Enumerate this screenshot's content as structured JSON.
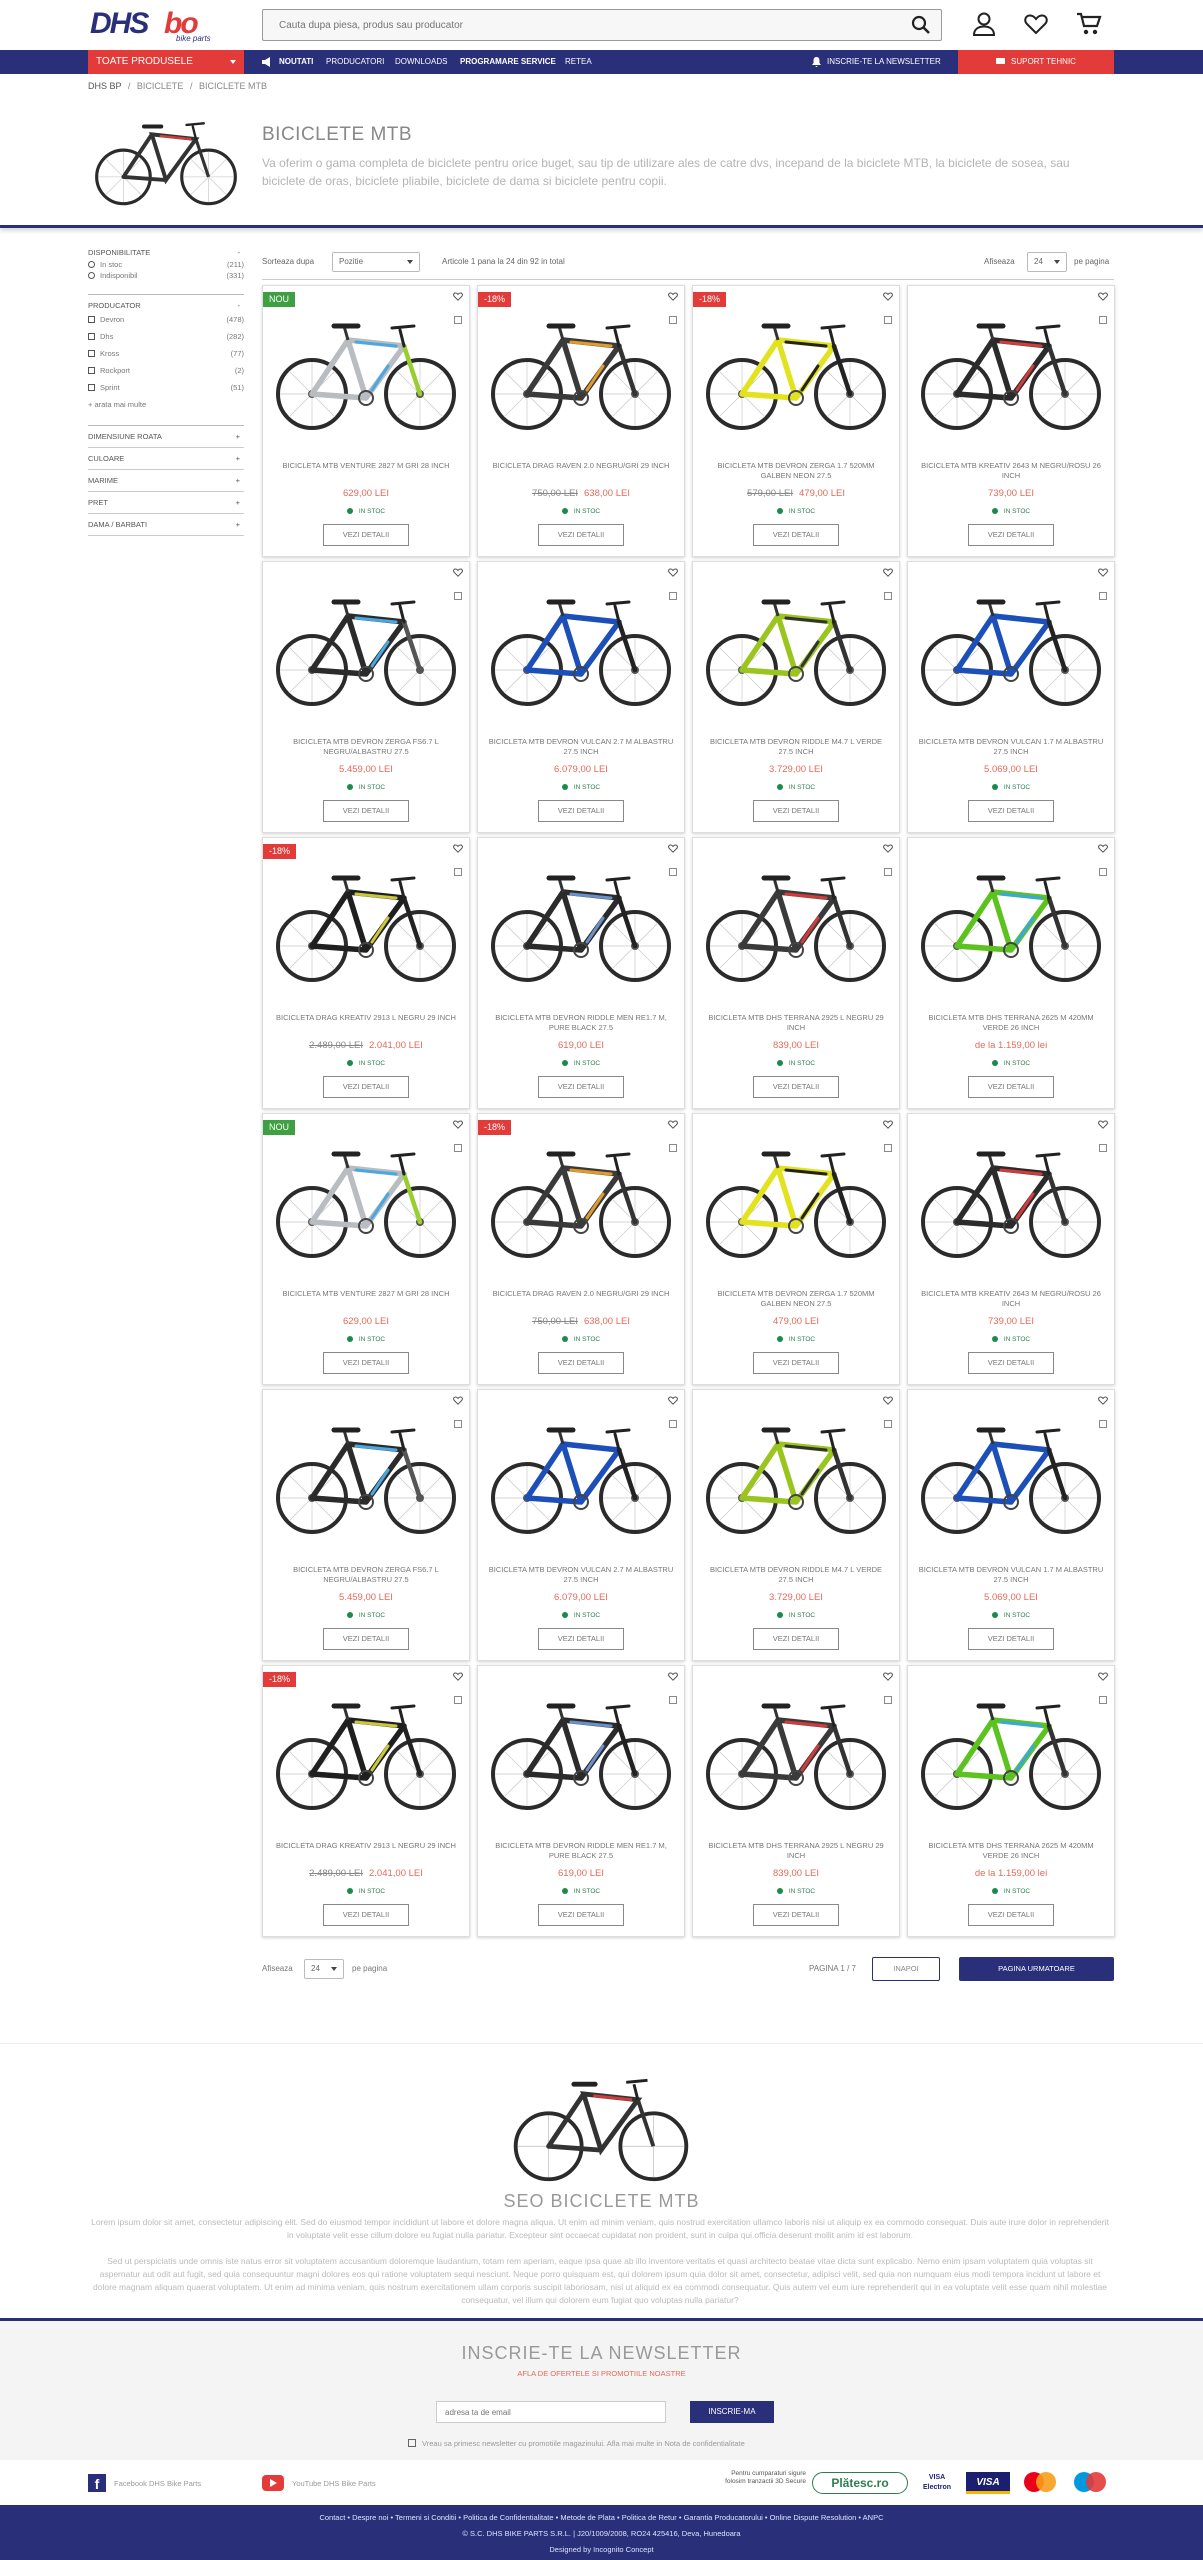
{
  "header": {
    "logo_text": "DHS",
    "logo_suffix": "bike parts",
    "search_placeholder": "Cauta dupa piesa, produs sau producator"
  },
  "nav": {
    "all_products": "TOATE PRODUSELE",
    "items": [
      "NOUTATI",
      "PRODUCATORI",
      "DOWNLOADS",
      "PROGRAMARE SERVICE",
      "RETEA"
    ],
    "newsletter": "INSCRIE-TE LA NEWSLETTER",
    "support": "SUPORT TEHNIC"
  },
  "breadcrumb": [
    "DHS BP",
    "BICICLETE",
    "BICICLETE MTB"
  ],
  "category": {
    "title": "BICICLETE MTB",
    "description": "Va oferim o gama completa de biciclete pentru orice buget, sau tip de utilizare ales de catre dvs, incepand de la biciclete MTB, la biciclete de sosea, sau biciclete de oras, biciclete pliabile, biciclete de dama si biciclete pentru copii."
  },
  "filters": {
    "availability": {
      "title": "DISPONIBILITATE",
      "toggle": "-",
      "items": [
        {
          "label": "In stoc",
          "count": "(211)"
        },
        {
          "label": "Indisponibil",
          "count": "(331)"
        }
      ]
    },
    "producer": {
      "title": "PRODUCATOR",
      "toggle": "-",
      "items": [
        {
          "label": "Devron",
          "count": "(478)"
        },
        {
          "label": "Dhs",
          "count": "(282)"
        },
        {
          "label": "Kross",
          "count": "(77)"
        },
        {
          "label": "Rockport",
          "count": "(2)"
        },
        {
          "label": "Sprint",
          "count": "(51)"
        }
      ],
      "more": "+ arata mai multe"
    },
    "collapsed": [
      {
        "label": "DIMENSIUNE ROATA",
        "toggle": "+"
      },
      {
        "label": "CULOARE",
        "toggle": "+"
      },
      {
        "label": "MARIME",
        "toggle": "+"
      },
      {
        "label": "PRET",
        "toggle": "+"
      },
      {
        "label": "DAMA / BARBATI",
        "toggle": "+"
      }
    ]
  },
  "toolbar": {
    "sort_label": "Sorteaza dupa",
    "sort_value": "Pozitie",
    "count_text": "Articole 1 pana la 24 din 92 in total",
    "show_label": "Afiseaza",
    "per_page_value": "24",
    "per_page_suffix": "pe pagina"
  },
  "products": [
    {
      "name": "BICICLETA MTB VENTURE 2827 M GRI 28 INCH",
      "price": "629,00 LEI",
      "old_price": "",
      "badge": "NOU",
      "badge_type": "new",
      "stock": "IN STOC",
      "button": "VEZI DETALII",
      "frame": "#b9bcc0",
      "accent": "#4aa8e0",
      "fork": "#9acd32"
    },
    {
      "name": "BICICLETA DRAG RAVEN 2.0 NEGRU/GRI 29 INCH",
      "price": "638,00 LEI",
      "old_price": "750,00 LEI",
      "badge": "-18%",
      "badge_type": "sale",
      "stock": "IN STOC",
      "button": "VEZI DETALII",
      "frame": "#3a3a3a",
      "accent": "#e29b2a",
      "fork": "#333333"
    },
    {
      "name": "BICICLETA MTB DEVRON ZERGA 1.7 520MM GALBEN NEON 27.5",
      "price": "479,00 LEI",
      "old_price": "579,00 LEI",
      "badge": "-18%",
      "badge_type": "sale",
      "stock": "IN STOC",
      "button": "VEZI DETALII",
      "frame": "#e3e21f",
      "accent": "#222222",
      "fork": "#222222"
    },
    {
      "name": "BICICLETA MTB KREATIV 2643 M NEGRU/ROSU 26 INCH",
      "price": "739,00 LEI",
      "old_price": "",
      "badge": "",
      "badge_type": "",
      "stock": "IN STOC",
      "button": "VEZI DETALII",
      "frame": "#2b2b2b",
      "accent": "#d23b3b",
      "fork": "#333333"
    },
    {
      "name": "BICICLETA MTB DEVRON ZERGA FS6.7 L NEGRU/ALBASTRU 27.5",
      "price": "5.459,00 LEI",
      "old_price": "",
      "badge": "",
      "badge_type": "",
      "stock": "IN STOC",
      "button": "VEZI DETALII",
      "frame": "#2b2b2b",
      "accent": "#4aa8e0",
      "fork": "#555555"
    },
    {
      "name": "BICICLETA MTB DEVRON VULCAN 2.7 M ALBASTRU 27.5 INCH",
      "price": "6.079,00 LEI",
      "old_price": "",
      "badge": "",
      "badge_type": "",
      "stock": "IN STOC",
      "button": "VEZI DETALII",
      "frame": "#1d4fb8",
      "accent": "#1d4fb8",
      "fork": "#222222"
    },
    {
      "name": "BICICLETA MTB DEVRON RIDDLE M4.7 L VERDE 27.5 INCH",
      "price": "3.729,00 LEI",
      "old_price": "",
      "badge": "",
      "badge_type": "",
      "stock": "IN STOC",
      "button": "VEZI DETALII",
      "frame": "#9ac51f",
      "accent": "#333333",
      "fork": "#333333"
    },
    {
      "name": "BICICLETA MTB DEVRON VULCAN 1.7 M ALBASTRU 27.5 INCH",
      "price": "5.069,00 LEI",
      "old_price": "",
      "badge": "",
      "badge_type": "",
      "stock": "IN STOC",
      "button": "VEZI DETALII",
      "frame": "#1d4fb8",
      "accent": "#1d4fb8",
      "fork": "#222222"
    },
    {
      "name": "BICICLETA DRAG KREATIV 2913 L NEGRU 29 INCH",
      "price": "2.041,00 LEI",
      "old_price": "2.489,00 LEI",
      "badge": "-18%",
      "badge_type": "sale",
      "stock": "IN STOC",
      "button": "VEZI DETALII",
      "frame": "#1f1f1f",
      "accent": "#c8c83a",
      "fork": "#222222"
    },
    {
      "name": "BICICLETA MTB DEVRON RIDDLE MEN RE1.7 M, PURE BLACK 27.5",
      "price": "619,00 LEI",
      "old_price": "",
      "badge": "",
      "badge_type": "",
      "stock": "IN STOC",
      "button": "VEZI DETALII",
      "frame": "#2b2b2b",
      "accent": "#6b8fc9",
      "fork": "#222222"
    },
    {
      "name": "BICICLETA MTB DHS TERRANA 2925 L NEGRU 29 INCH",
      "price": "839,00 LEI",
      "old_price": "",
      "badge": "",
      "badge_type": "",
      "stock": "IN STOC",
      "button": "VEZI DETALII",
      "frame": "#3a3a3a",
      "accent": "#d23b3b",
      "fork": "#333333"
    },
    {
      "name": "BICICLETA MTB DHS TERRANA 2625 M 420MM VERDE 26 INCH",
      "price": "de la 1.159,00 lei",
      "old_price": "",
      "badge": "",
      "badge_type": "",
      "stock": "IN STOC",
      "button": "VEZI DETALII",
      "frame": "#5cc21f",
      "accent": "#3aa8e0",
      "fork": "#333333"
    },
    {
      "name": "BICICLETA MTB VENTURE 2827 M GRI 28 INCH",
      "price": "629,00 LEI",
      "old_price": "",
      "badge": "NOU",
      "badge_type": "new",
      "stock": "IN STOC",
      "button": "VEZI DETALII",
      "frame": "#b9bcc0",
      "accent": "#4aa8e0",
      "fork": "#9acd32"
    },
    {
      "name": "BICICLETA DRAG RAVEN 2.0 NEGRU/GRI 29 INCH",
      "price": "638,00 LEI",
      "old_price": "750,00 LEI",
      "badge": "-18%",
      "badge_type": "sale",
      "stock": "IN STOC",
      "button": "VEZI DETALII",
      "frame": "#3a3a3a",
      "accent": "#e29b2a",
      "fork": "#333333"
    },
    {
      "name": "BICICLETA MTB DEVRON ZERGA 1.7 520MM GALBEN NEON 27.5",
      "price": "479,00 LEI",
      "old_price": "",
      "badge": "",
      "badge_type": "",
      "stock": "IN STOC",
      "button": "VEZI DETALII",
      "frame": "#e3e21f",
      "accent": "#222222",
      "fork": "#222222"
    },
    {
      "name": "BICICLETA MTB KREATIV 2643 M NEGRU/ROSU 26 INCH",
      "price": "739,00 LEI",
      "old_price": "",
      "badge": "",
      "badge_type": "",
      "stock": "IN STOC",
      "button": "VEZI DETALII",
      "frame": "#2b2b2b",
      "accent": "#d23b3b",
      "fork": "#333333"
    },
    {
      "name": "BICICLETA MTB DEVRON ZERGA FS6.7 L NEGRU/ALBASTRU 27.5",
      "price": "5.459,00 LEI",
      "old_price": "",
      "badge": "",
      "badge_type": "",
      "stock": "IN STOC",
      "button": "VEZI DETALII",
      "frame": "#2b2b2b",
      "accent": "#4aa8e0",
      "fork": "#555555"
    },
    {
      "name": "BICICLETA MTB DEVRON VULCAN 2.7 M ALBASTRU 27.5 INCH",
      "price": "6.079,00 LEI",
      "old_price": "",
      "badge": "",
      "badge_type": "",
      "stock": "IN STOC",
      "button": "VEZI DETALII",
      "frame": "#1d4fb8",
      "accent": "#1d4fb8",
      "fork": "#222222"
    },
    {
      "name": "BICICLETA MTB DEVRON RIDDLE M4.7 L VERDE 27.5 INCH",
      "price": "3.729,00 LEI",
      "old_price": "",
      "badge": "",
      "badge_type": "",
      "stock": "IN STOC",
      "button": "VEZI DETALII",
      "frame": "#9ac51f",
      "accent": "#333333",
      "fork": "#333333"
    },
    {
      "name": "BICICLETA MTB DEVRON VULCAN 1.7 M ALBASTRU 27.5 INCH",
      "price": "5.069,00 LEI",
      "old_price": "",
      "badge": "",
      "badge_type": "",
      "stock": "IN STOC",
      "button": "VEZI DETALII",
      "frame": "#1d4fb8",
      "accent": "#1d4fb8",
      "fork": "#222222"
    },
    {
      "name": "BICICLETA DRAG KREATIV 2913 L NEGRU 29 INCH",
      "price": "2.041,00 LEI",
      "old_price": "2.489,00 LEI",
      "badge": "-18%",
      "badge_type": "sale",
      "stock": "IN STOC",
      "button": "VEZI DETALII",
      "frame": "#1f1f1f",
      "accent": "#c8c83a",
      "fork": "#222222"
    },
    {
      "name": "BICICLETA MTB DEVRON RIDDLE MEN RE1.7 M, PURE BLACK 27.5",
      "price": "619,00 LEI",
      "old_price": "",
      "badge": "",
      "badge_type": "",
      "stock": "IN STOC",
      "button": "VEZI DETALII",
      "frame": "#2b2b2b",
      "accent": "#6b8fc9",
      "fork": "#222222"
    },
    {
      "name": "BICICLETA MTB DHS TERRANA 2925 L NEGRU 29 INCH",
      "price": "839,00 LEI",
      "old_price": "",
      "badge": "",
      "badge_type": "",
      "stock": "IN STOC",
      "button": "VEZI DETALII",
      "frame": "#3a3a3a",
      "accent": "#d23b3b",
      "fork": "#333333"
    },
    {
      "name": "BICICLETA MTB DHS TERRANA 2625 M 420MM VERDE 26 INCH",
      "price": "de la 1.159,00 lei",
      "old_price": "",
      "badge": "",
      "badge_type": "",
      "stock": "IN STOC",
      "button": "VEZI DETALII",
      "frame": "#5cc21f",
      "accent": "#3aa8e0",
      "fork": "#333333"
    }
  ],
  "pagination": {
    "show_label": "Afiseaza",
    "per_page_value": "24",
    "per_page_suffix": "pe pagina",
    "page_text": "PAGINA 1 / 7",
    "back": "INAPOI",
    "next": "PAGINA URMATOARE"
  },
  "seo": {
    "title": "SEO BICICLETE MTB",
    "paragraph1": "Lorem ipsum dolor sit amet, consectetur adipiscing elit. Sed do eiusmod tempor incididunt ut labore et dolore magna aliqua. Ut enim ad minim veniam, quis nostrud exercitation ullamco laboris nisi ut aliquip ex ea commodo consequat. Duis aute irure dolor in reprehenderit in voluptate velit esse cillum dolore eu fugiat nulla pariatur. Excepteur sint occaecat cupidatat non proident, sunt in culpa qui officia deserunt mollit anim id est laborum.",
    "paragraph2": "Sed ut perspiciatis unde omnis iste natus error sit voluptatem accusantium doloremque laudantium, totam rem aperiam, eaque ipsa quae ab illo inventore veritatis et quasi architecto beatae vitae dicta sunt explicabo. Nemo enim ipsam voluptatem quia voluptas sit aspernatur aut odit aut fugit, sed quia consequuntur magni dolores eos qui ratione voluptatem sequi nesciunt. Neque porro quisquam est, qui dolorem ipsum quia dolor sit amet, consectetur, adipisci velit, sed quia non numquam eius modi tempora incidunt ut labore et dolore magnam aliquam quaerat voluptatem. Ut enim ad minima veniam, quis nostrum exercitationem ullam corporis suscipit laboriosam, nisi ut aliquid ex ea commodi consequatur. Quis autem vel eum iure reprehenderit qui in ea voluptate velit esse quam nihil molestiae consequatur, vel illum qui dolorem eum fugiat quo voluptas nulla pariatur?"
  },
  "newsletter": {
    "title": "INSCRIE-TE LA NEWSLETTER",
    "subtitle": "AFLA DE OFERTELE SI PROMOTIILE NOASTRE",
    "placeholder": "adresa ta de email",
    "button": "INSCRIE-MA",
    "agree": "Vreau sa primesc newsletter cu promotiile magazinului. Afla mai multe in Nota de confidentialitate"
  },
  "social": {
    "facebook": "Facebook DHS Bike Parts",
    "youtube": "YouTube DHS Bike Parts",
    "payments_note": "Pentru cumparaturi sigure folosim tranzactii 3D Secure",
    "platesc": "Plătesc.ro",
    "visa_electron": "VISA Electron",
    "visa": "VISA"
  },
  "footer": {
    "links": "Contact • Despre noi • Termeni si Conditii • Politica de Confidentialitate • Metode de Plata • Politica de Retur • Garantia Producatorului • Online Dispute Resolution • ANPC",
    "company": "© S.C. DHS BIKE PARTS S.R.L.  |  J20/1009/2008, RO24 425416, Deva, Hunedoara",
    "designer": "Designed by Incognito Concept"
  },
  "colors": {
    "primary": "#2a2f7a",
    "accent": "#e23b39",
    "price": "#e26a5a",
    "stock": "#1d8a4d"
  }
}
